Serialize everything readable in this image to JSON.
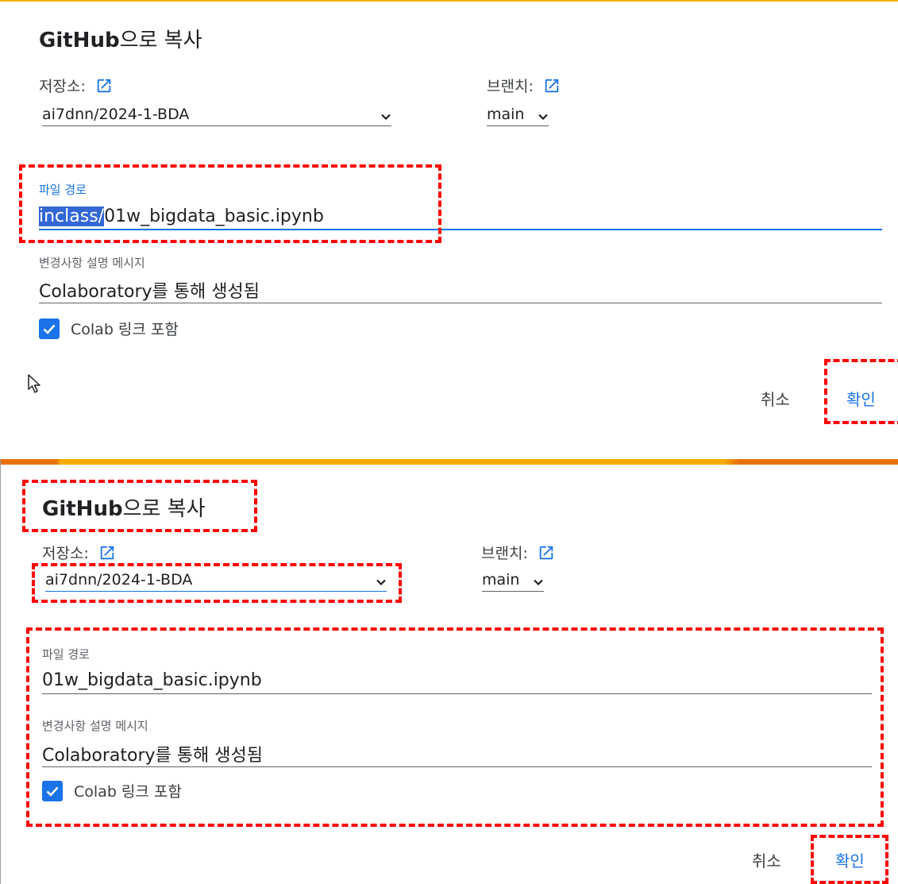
{
  "dialog_before": {
    "title_en": "GitHub",
    "title_ko": "으로 복사",
    "repo_label": "저장소:",
    "repo_value": "ai7dnn/2024-1-BDA",
    "branch_label": "브랜치:",
    "branch_value": "main",
    "path_label": "파일 경로",
    "path_selected": "inclass/",
    "path_rest": "01w_bigdata_basic.ipynb",
    "message_label": "변경사항 설명 메시지",
    "message_value": "Colaboratory를 통해 생성됨",
    "checkbox_label": "Colab 링크 포함",
    "cancel_label": "취소",
    "ok_label": "확인"
  },
  "dialog_after": {
    "title_en": "GitHub",
    "title_ko": "으로 복사",
    "repo_label": "저장소:",
    "repo_value": "ai7dnn/2024-1-BDA",
    "branch_label": "브랜치:",
    "branch_value": "main",
    "path_label": "파일 경로",
    "path_value": "01w_bigdata_basic.ipynb",
    "message_label": "변경사항 설명 메시지",
    "message_value": "Colaboratory를 통해 생성됨",
    "checkbox_label": "Colab 링크 포함",
    "cancel_label": "취소",
    "ok_label": "확인"
  },
  "colors": {
    "accent": "#1a73e8",
    "highlight_border": "#ff0000",
    "top_bar_orange": "#e8710a",
    "top_bar_yellow": "#f9ab00"
  }
}
